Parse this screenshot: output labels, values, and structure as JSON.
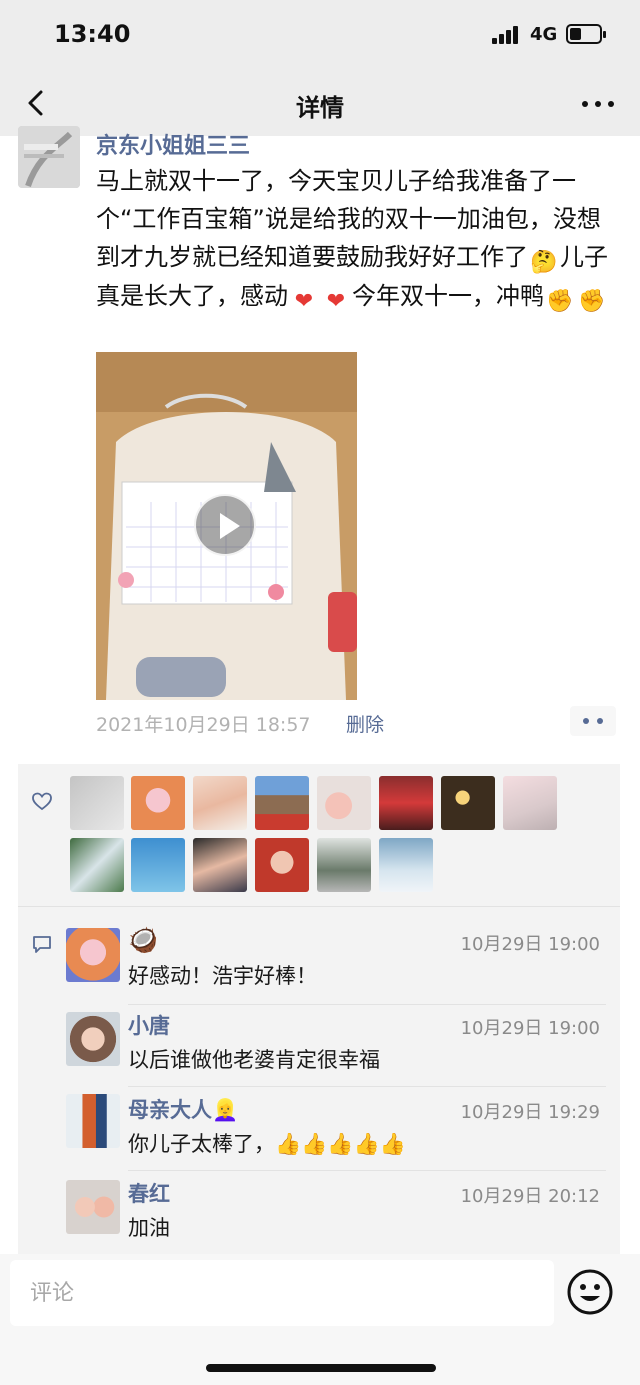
{
  "status_bar": {
    "time": "13:40",
    "network": "4G",
    "battery_level": 0.4
  },
  "nav": {
    "title": "详情"
  },
  "post": {
    "author": "京东小姐姐三三",
    "text_1": "马上就双十一了，今天宝贝儿子给我准备了一个“工作百宝箱”说是给我的双十一加油包，没想到才九岁就已经知道要鼓励我好好工作了",
    "text_2": "儿子真是长大了，感动",
    "text_3": "今年双十一，冲鸭",
    "emoji_think": "🤔",
    "emoji_heart": "❤",
    "emoji_fist": "✊",
    "time": "2021年10月29日 18:57",
    "delete_label": "删除"
  },
  "comments": [
    {
      "name": "🥥",
      "time": "10月29日 19:00",
      "text": "好感动！浩宇好棒！"
    },
    {
      "name": "小唐",
      "time": "10月29日 19:00",
      "text": "以后谁做他老婆肯定很幸福"
    },
    {
      "name": "母亲大人👱‍♀️",
      "time": "10月29日 19:29",
      "text": "你儿子太棒了，👍👍👍👍👍"
    },
    {
      "name": "春红",
      "time": "10月29日 20:12",
      "text": "加油"
    }
  ],
  "input": {
    "placeholder": "评论"
  },
  "colors": {
    "link": "#576b95",
    "bg_gray": "#ededed",
    "panel": "#f3f3f3"
  },
  "icons": {
    "back": "chevron-left-icon",
    "more": "more-icon",
    "like": "heart-outline-icon",
    "comment": "comment-icon",
    "emoji": "smiley-icon"
  }
}
